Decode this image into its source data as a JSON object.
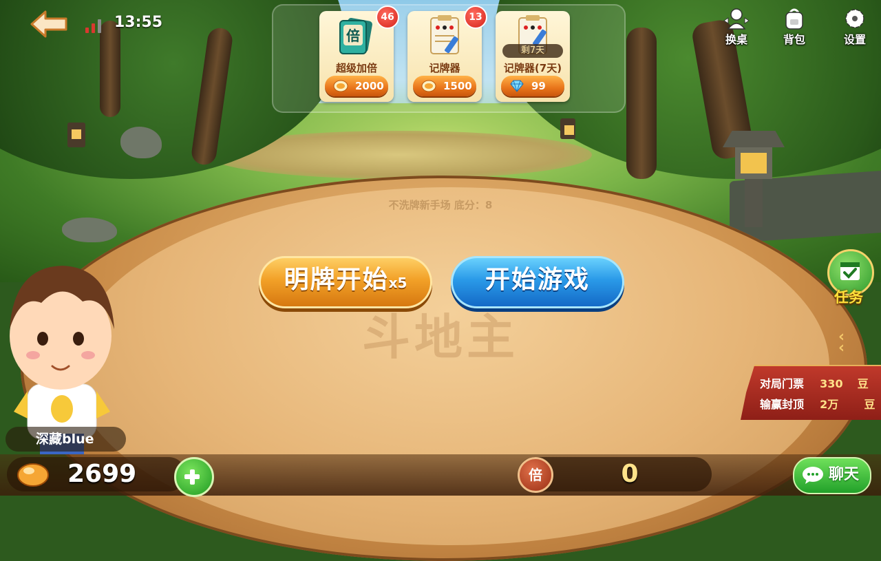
{
  "status": {
    "time": "13:55"
  },
  "shop": [
    {
      "label": "超级加倍",
      "price": "2000",
      "badge": "46",
      "currency": "bean-icon",
      "thumb_text": "倍"
    },
    {
      "label": "记牌器",
      "price": "1500",
      "badge": "13",
      "currency": "bean-icon"
    },
    {
      "label": "记牌器(7天)",
      "price": "99",
      "remain": "剩7天",
      "currency": "diamond-icon"
    }
  ],
  "top_buttons": {
    "switch_table": "换桌",
    "backpack": "背包",
    "settings": "设置"
  },
  "room": {
    "info": "不洗牌新手场 底分：8"
  },
  "actions": {
    "show_cards_start": "明牌开始",
    "show_cards_multiplier": "x5",
    "start_game": "开始游戏"
  },
  "task": {
    "label": "任务"
  },
  "ticket": {
    "fee_label": "对局门票",
    "fee_value": "330",
    "fee_unit": "豆",
    "cap_label": "输赢封顶",
    "cap_value": "2万",
    "cap_unit": "豆"
  },
  "player": {
    "name": "深藏blue",
    "beans": "2699"
  },
  "multiplier": {
    "icon_text": "倍",
    "value": "0"
  },
  "chat": {
    "label": "聊天"
  },
  "colors": {
    "start_button": "#2a9ae8",
    "show_button": "#f2a128",
    "accent_green": "#22a12a"
  }
}
